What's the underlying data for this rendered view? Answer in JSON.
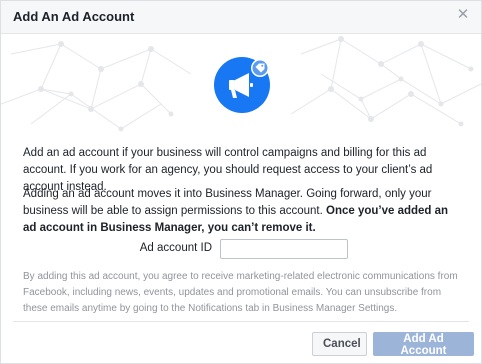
{
  "dialog": {
    "title": "Add An Ad Account",
    "close_icon": "close-icon"
  },
  "hero": {
    "icon": "megaphone-icon",
    "badge_icon": "tag-icon",
    "accent": "#1877f2"
  },
  "body": {
    "paragraph1": "Add an ad account if your business will control campaigns and billing for this ad account. If you work for an agency, you should request access to your client’s ad account instead.",
    "paragraph2_normal": "Adding an ad account moves it into Business Manager. Going forward, only your business will be able to assign permissions to this account. ",
    "paragraph2_bold": "Once you’ve added an ad account in Business Manager, you can’t remove it."
  },
  "form": {
    "ad_account_id_label": "Ad account ID",
    "ad_account_id_value": ""
  },
  "disclaimer": "By adding this ad account, you agree to receive marketing-related electronic communications from Facebook, including news, events, updates and promotional emails. You can unsubscribe from these emails anytime by going to the Notifications tab in Business Manager Settings.",
  "footer": {
    "cancel_label": "Cancel",
    "add_label": "Add Ad Account"
  }
}
